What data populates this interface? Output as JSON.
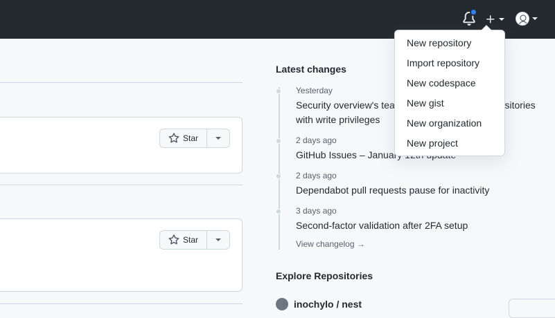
{
  "header": {
    "notifications_icon": "bell-icon",
    "create_icon": "plus-icon",
    "avatar_icon": "user-avatar"
  },
  "colors": {
    "header_bg": "#24292f",
    "notification_dot": "#2f81f7",
    "page_bg": "#f6f8fa"
  },
  "feed": {
    "cards": [
      {
        "star_label": "Star"
      },
      {
        "star_label": "Star"
      }
    ]
  },
  "latest_changes": {
    "title": "Latest changes",
    "items": [
      {
        "date": "Yesterday",
        "text": "Security overview's team filter now includes repositories with write privileges"
      },
      {
        "date": "2 days ago",
        "text": "GitHub Issues – January 12th update"
      },
      {
        "date": "2 days ago",
        "text": "Dependabot pull requests pause for inactivity"
      },
      {
        "date": "3 days ago",
        "text": "Second-factor validation after 2FA setup"
      }
    ],
    "view_changelog": "View changelog →"
  },
  "explore": {
    "title": "Explore Repositories",
    "first_repo": "inochylo / nest"
  },
  "create_menu": {
    "items": [
      "New repository",
      "Import repository",
      "New codespace",
      "New gist",
      "New organization",
      "New project"
    ]
  }
}
